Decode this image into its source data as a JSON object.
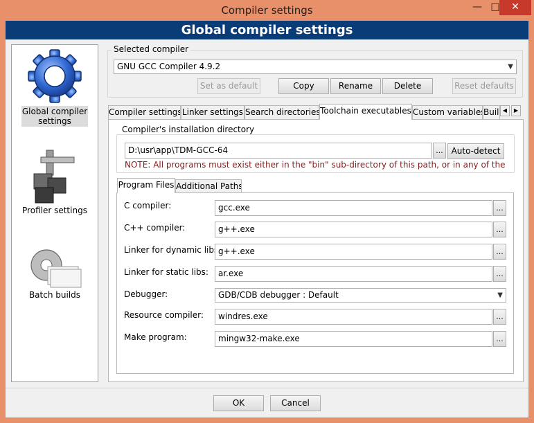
{
  "window": {
    "title": "Compiler settings",
    "minimize_glyph": "—",
    "maximize_glyph": "□",
    "close_glyph": "✕"
  },
  "banner": {
    "title": "Global compiler settings"
  },
  "sidebar": {
    "items": [
      {
        "label": "Global compiler settings",
        "icon": "gear-icon",
        "selected": true
      },
      {
        "label": "Profiler settings",
        "icon": "profiler-icon",
        "selected": false
      },
      {
        "label": "Batch builds",
        "icon": "batch-builds-icon",
        "selected": false
      }
    ]
  },
  "selected_compiler": {
    "group_label": "Selected compiler",
    "value": "GNU GCC Compiler 4.9.2",
    "buttons": {
      "set_default": "Set as default",
      "copy": "Copy",
      "rename": "Rename",
      "delete": "Delete",
      "reset_defaults": "Reset defaults"
    }
  },
  "tabs": {
    "items": [
      "Compiler settings",
      "Linker settings",
      "Search directories",
      "Toolchain executables",
      "Custom variables",
      "Build"
    ],
    "active_index": 3,
    "scroll_left": "◀",
    "scroll_right": "▶"
  },
  "installation": {
    "group_label": "Compiler's installation directory",
    "path": "D:\\usr\\app\\TDM-GCC-64",
    "browse": "...",
    "auto_detect": "Auto-detect",
    "note": "NOTE: All programs must exist either in the \"bin\" sub-directory of this path, or in any of the"
  },
  "subtabs": {
    "items": [
      "Program Files",
      "Additional Paths"
    ],
    "active_index": 0
  },
  "programs": {
    "browse": "...",
    "c_compiler": {
      "label": "C compiler:",
      "value": "gcc.exe"
    },
    "cpp_compiler": {
      "label": "C++ compiler:",
      "value": "g++.exe"
    },
    "linker_dynamic": {
      "label": "Linker for dynamic libs:",
      "value": "g++.exe"
    },
    "linker_static": {
      "label": "Linker for static libs:",
      "value": "ar.exe"
    },
    "debugger": {
      "label": "Debugger:",
      "value": "GDB/CDB debugger : Default"
    },
    "resource_compiler": {
      "label": "Resource compiler:",
      "value": "windres.exe"
    },
    "make_program": {
      "label": "Make program:",
      "value": "mingw32-make.exe"
    }
  },
  "footer": {
    "ok": "OK",
    "cancel": "Cancel"
  },
  "colors": {
    "frame": "#e8906a",
    "banner": "#0a3c78",
    "close": "#c7392b",
    "note": "#8b1a1a"
  }
}
